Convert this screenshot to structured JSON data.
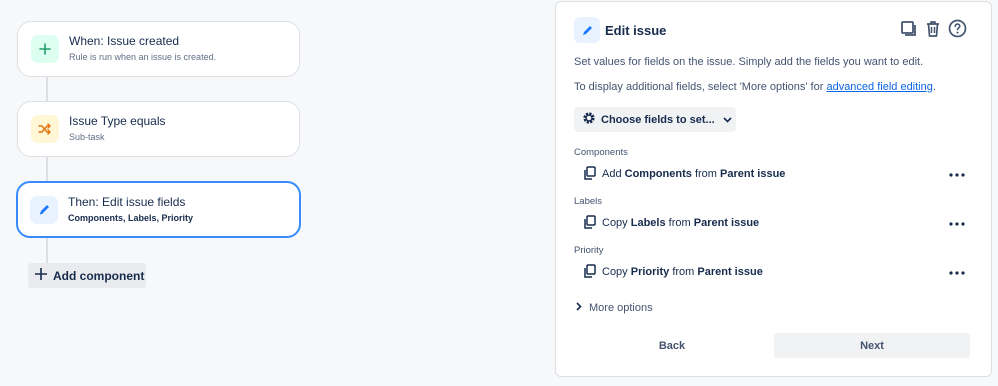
{
  "rule": {
    "trigger": {
      "title": "When: Issue created",
      "subtitle": "Rule is run when an issue is created.",
      "icon": "plus-icon",
      "color": "#22a06b"
    },
    "condition": {
      "title": "Issue Type equals",
      "subtitle": "Sub-task",
      "icon": "shuffle-icon",
      "color": "#e2740f"
    },
    "action": {
      "title": "Then: Edit issue fields",
      "subtitle": "Components, Labels, Priority",
      "icon": "pencil-icon",
      "color": "#0c66e4"
    },
    "add_component_label": "Add component"
  },
  "panel": {
    "title": "Edit issue",
    "description": "Set values for fields on the issue. Simply add the fields you want to edit.",
    "additional_prefix": "To display additional fields, select 'More options' for ",
    "additional_link": "advanced field editing",
    "additional_suffix": ".",
    "choose_fields_label": "Choose fields to set...",
    "fields": [
      {
        "label": "Components",
        "verb": "Add",
        "field": "Components",
        "from": "from",
        "source": "Parent issue"
      },
      {
        "label": "Labels",
        "verb": "Copy",
        "field": "Labels",
        "from": "from",
        "source": "Parent issue"
      },
      {
        "label": "Priority",
        "verb": "Copy",
        "field": "Priority",
        "from": "from",
        "source": "Parent issue"
      }
    ],
    "more_options_label": "More options",
    "back_label": "Back",
    "next_label": "Next"
  }
}
